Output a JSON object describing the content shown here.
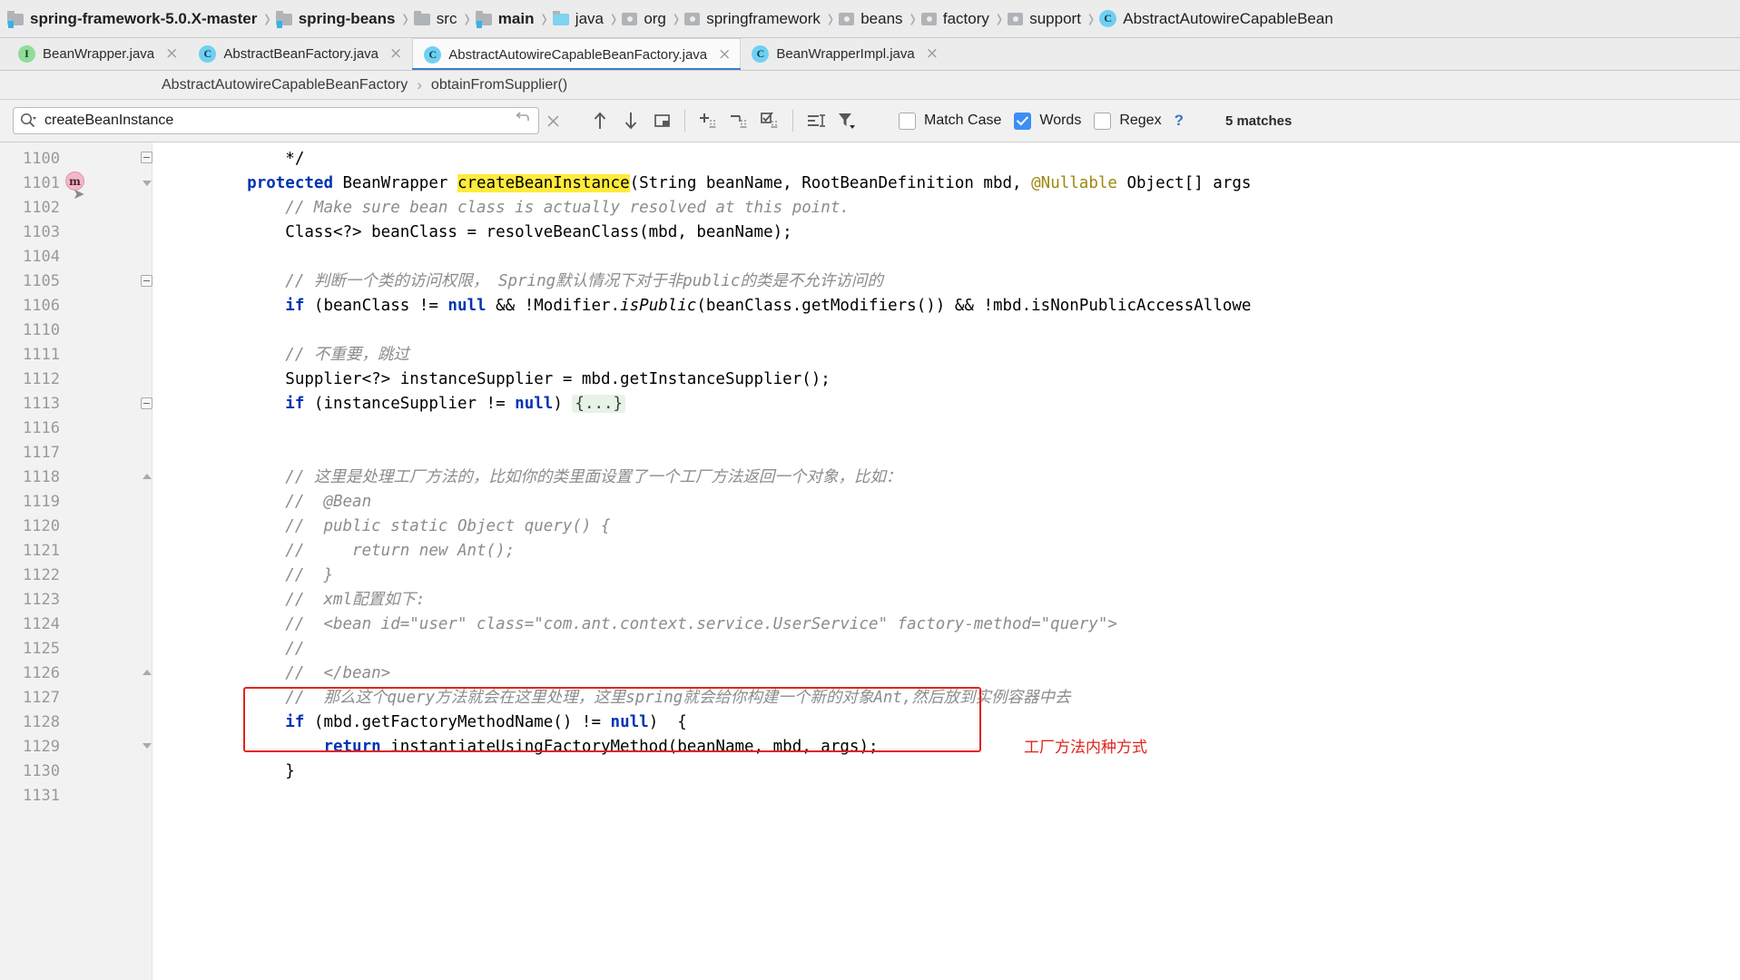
{
  "path_bar": {
    "crumbs": [
      {
        "label": "spring-framework-5.0.X-master",
        "icon": "module-folder-icon",
        "bold": true,
        "type": "mod"
      },
      {
        "label": "spring-beans",
        "icon": "module-folder-icon",
        "bold": true,
        "type": "mod"
      },
      {
        "label": "src",
        "icon": "folder-icon",
        "bold": false,
        "type": "src"
      },
      {
        "label": "main",
        "icon": "module-folder-icon",
        "bold": true,
        "type": "mod"
      },
      {
        "label": "java",
        "icon": "source-folder-icon",
        "bold": false,
        "type": "java"
      },
      {
        "label": "org",
        "icon": "package-icon",
        "bold": false,
        "type": "pkg"
      },
      {
        "label": "springframework",
        "icon": "package-icon",
        "bold": false,
        "type": "pkg"
      },
      {
        "label": "beans",
        "icon": "package-icon",
        "bold": false,
        "type": "pkg"
      },
      {
        "label": "factory",
        "icon": "package-icon",
        "bold": false,
        "type": "pkg"
      },
      {
        "label": "support",
        "icon": "package-icon",
        "bold": false,
        "type": "pkg"
      },
      {
        "label": "AbstractAutowireCapableBean",
        "icon": "java-class-icon",
        "bold": false,
        "type": "class"
      }
    ]
  },
  "tabs": [
    {
      "label": "BeanWrapper.java",
      "icon": "java-interface-icon",
      "marker": "I",
      "active": false,
      "close": "×"
    },
    {
      "label": "AbstractBeanFactory.java",
      "icon": "java-class-icon",
      "marker": "C",
      "active": false,
      "close": "×"
    },
    {
      "label": "AbstractAutowireCapableBeanFactory.java",
      "icon": "java-class-icon",
      "marker": "C",
      "active": true,
      "close": "×"
    },
    {
      "label": "BeanWrapperImpl.java",
      "icon": "java-class-icon",
      "marker": "C",
      "active": false,
      "close": "×"
    }
  ],
  "member_bar": {
    "class_name": "AbstractAutowireCapableBeanFactory",
    "separator": "›",
    "method_name": "obtainFromSupplier()"
  },
  "find": {
    "query": "createBeanInstance",
    "placeholder": "Search",
    "search_icon": "magnifier-with-dropdown-icon",
    "history_icon": "search-history-icon",
    "clear_icon": "clear-search-icon",
    "prev_icon": "find-previous-icon",
    "next_icon": "find-next-icon",
    "select_all_icon": "open-in-find-window-icon",
    "add_icon": "add-occurrence-icon",
    "remove_icon": "remove-occurrence-icon",
    "select_occurrences_icon": "select-all-occurrences-icon",
    "filter_list_icon": "in-selection-icon",
    "filter_icon": "filter-dropdown-icon",
    "options": [
      {
        "label": "Match Case",
        "checked": false
      },
      {
        "label": "Words",
        "checked": true
      },
      {
        "label": "Regex",
        "checked": false
      }
    ],
    "help_label": "?",
    "match_count": "5 matches"
  },
  "editor": {
    "line_numbers": [
      "1100",
      "1101",
      "1102",
      "1103",
      "1104",
      "1105",
      "1106",
      "1110",
      "1111",
      "1112",
      "1113",
      "1116",
      "1117",
      "1118",
      "1119",
      "1120",
      "1121",
      "1122",
      "1123",
      "1124",
      "1125",
      "1126",
      "1127",
      "1128",
      "1129",
      "1130",
      "1131"
    ],
    "breakpoint_marker": "m",
    "code_lines": [
      "        */",
      "    protected BeanWrapper createBeanInstance(String beanName, RootBeanDefinition mbd, @Nullable Object[] args",
      "        // Make sure bean class is actually resolved at this point.",
      "        Class<?> beanClass = resolveBeanClass(mbd, beanName);",
      "",
      "        // 判断一个类的访问权限， Spring默认情况下对于非public的类是不允许访问的",
      "        if (beanClass != null && !Modifier.isPublic(beanClass.getModifiers()) && !mbd.isNonPublicAccessAllowe",
      "",
      "        // 不重要，跳过",
      "        Supplier<?> instanceSupplier = mbd.getInstanceSupplier();",
      "        if (instanceSupplier != null) {...}",
      "",
      "",
      "        // 这里是处理工厂方法的，比如你的类里面设置了一个工厂方法返回一个对象，比如：",
      "        //  @Bean",
      "        //  public static Object query() {",
      "        //     return new Ant();",
      "        //  }",
      "        //  xml配置如下:",
      "        //  <bean id=\"user\" class=\"com.ant.context.service.UserService\" factory-method=\"query\">",
      "        //",
      "        //  </bean>",
      "        //  那么这个query方法就会在这里处理，这里spring就会给你构建一个新的对象Ant,然后放到实例容器中去",
      "        if (mbd.getFactoryMethodName() != null)  {",
      "            return instantiateUsingFactoryMethod(beanName, mbd, args);",
      "        }",
      ""
    ],
    "highlighted_term": "createBeanInstance",
    "annotation": {
      "note_text": "工厂方法内种方式",
      "note_color": "#e2231a",
      "box_color": "#e2231a"
    }
  }
}
